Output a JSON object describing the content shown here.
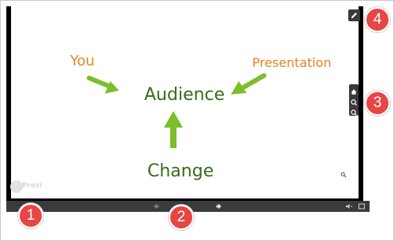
{
  "slide": {
    "words": {
      "you": "You",
      "presentation": "Presentation",
      "audience": "Audience",
      "change": "Change"
    },
    "colors": {
      "orange": "#e8821e",
      "dark_green": "#3a6b18",
      "arrow_green": "#7cbf2a",
      "callout_red": "#e84545"
    }
  },
  "watermark": {
    "text": "Prezi"
  },
  "toolbar": {
    "edit_icon": "pencil-icon",
    "zoom_controls": [
      "home-icon",
      "zoom-in-icon",
      "zoom-out-icon"
    ]
  },
  "bottom_bar": {
    "prev_icon": "left-arrow-icon",
    "next_icon": "right-arrow-icon",
    "volume_icon": "speaker-icon",
    "fullscreen_icon": "fullscreen-icon"
  },
  "callouts": [
    "1",
    "2",
    "3",
    "4"
  ]
}
